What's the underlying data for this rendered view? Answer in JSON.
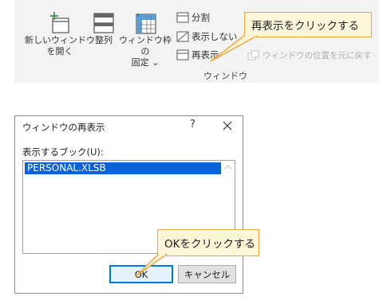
{
  "ribbon": {
    "new_window": {
      "label_line1": "新しいウィンドウ",
      "label_line2": "を開く",
      "icon": "new-window-icon"
    },
    "arrange_all": {
      "label": "整列",
      "icon": "arrange-all-icon"
    },
    "freeze_panes": {
      "label_line1": "ウィンドウ枠の",
      "label_line2": "固定 ⌄",
      "icon": "freeze-panes-icon"
    },
    "split": {
      "label": "分割",
      "icon": "split-icon"
    },
    "hide": {
      "label": "表示しない",
      "icon": "hide-icon"
    },
    "unhide": {
      "label": "再表示",
      "icon": "unhide-icon"
    },
    "reset_position": {
      "label": "ウィンドウの位置を元に戻す",
      "icon": "reset-position-icon"
    },
    "group_label": "ウィンドウ"
  },
  "callouts": {
    "top": "再表示をクリックする",
    "bottom": "OKをクリックする"
  },
  "dialog": {
    "title": "ウィンドウの再表示",
    "help": "?",
    "list_label": "表示するブック(U):",
    "items": [
      "PERSONAL.XLSB"
    ],
    "ok_label": "OK",
    "cancel_label": "キャンセル"
  },
  "colors": {
    "ribbon_bg": "#f3f3f3",
    "callout_bg": "#fdf6d8",
    "callout_border": "#f0a83c",
    "selection": "#0a64d7",
    "ok_border": "#0078d7"
  }
}
